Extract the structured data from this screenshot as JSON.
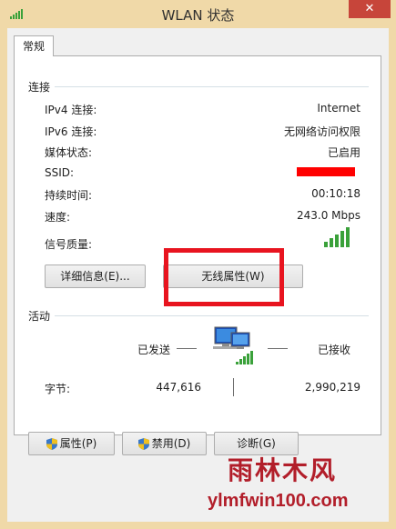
{
  "window": {
    "title": "WLAN 状态",
    "close_glyph": "✕"
  },
  "tabs": [
    {
      "label": "常规"
    }
  ],
  "connection": {
    "heading": "连接",
    "rows": [
      {
        "label": "IPv4 连接:",
        "value": "Internet"
      },
      {
        "label": "IPv6 连接:",
        "value": "无网络访问权限"
      },
      {
        "label": "媒体状态:",
        "value": "已启用"
      },
      {
        "label": "SSID:",
        "value": ""
      },
      {
        "label": "持续时间:",
        "value": "00:10:18"
      },
      {
        "label": "速度:",
        "value": "243.0 Mbps"
      },
      {
        "label": "信号质量:",
        "value": ""
      }
    ],
    "signal_bars_lit": 5,
    "signal_bars_total": 5
  },
  "buttons": {
    "details": "详细信息(E)...",
    "wireless_properties": "无线属性(W)"
  },
  "activity": {
    "heading": "活动",
    "sent_label": "已发送",
    "received_label": "已接收",
    "bytes_label": "字节:",
    "bytes_sent": "447,616",
    "bytes_received": "2,990,219"
  },
  "footer": {
    "properties": "属性(P)",
    "disable": "禁用(D)",
    "diagnose": "诊断(G)"
  },
  "watermark": {
    "text": "雨林木风",
    "url": "ylmfwin100.com"
  },
  "colors": {
    "accent": "#e8141f",
    "signal": "#3aa13a",
    "title_bar": "#f0d9a8"
  }
}
